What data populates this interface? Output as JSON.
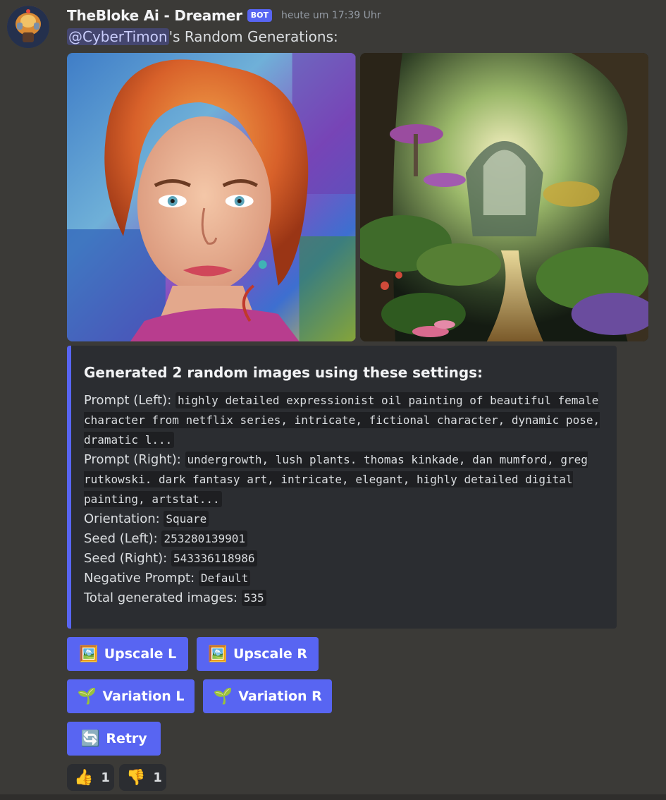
{
  "message": {
    "username": "TheBloke Ai - Dreamer",
    "badge": "BOT",
    "timestamp": "heute um 17:39 Uhr",
    "mention": "@CyberTimon",
    "content_suffix": "'s Random Generations:"
  },
  "embed": {
    "title": "Generated 2 random images using these settings:",
    "fields": [
      {
        "label": "Prompt (Left):",
        "value": "highly detailed expressionist oil painting of beautiful female character from netflix series, intricate, fictional character, dynamic pose, dramatic l..."
      },
      {
        "label": "Prompt (Right):",
        "value": "undergrowth, lush plants. thomas kinkade, dan mumford, greg rutkowski. dark fantasy art, intricate, elegant, highly detailed digital painting, artstat..."
      },
      {
        "label": "Orientation:",
        "value": "Square"
      },
      {
        "label": "Seed (Left):",
        "value": "253280139901"
      },
      {
        "label": "Seed (Right):",
        "value": "543336118986"
      },
      {
        "label": "Negative Prompt:",
        "value": "Default"
      },
      {
        "label": "Total generated images:",
        "value": "535"
      }
    ]
  },
  "buttons": {
    "upscale_left": {
      "emoji": "🖼️",
      "label": "Upscale L"
    },
    "upscale_right": {
      "emoji": "🖼️",
      "label": "Upscale R"
    },
    "variation_left": {
      "emoji": "🌱",
      "label": "Variation L"
    },
    "variation_right": {
      "emoji": "🌱",
      "label": "Variation R"
    },
    "retry": {
      "emoji": "🔄",
      "label": "Retry"
    }
  },
  "reactions": [
    {
      "emoji": "👍",
      "count": "1"
    },
    {
      "emoji": "👎",
      "count": "1"
    }
  ],
  "colors": {
    "background": "#3b3a37",
    "blurple": "#5865f2",
    "embed_bg": "#2b2d31"
  }
}
